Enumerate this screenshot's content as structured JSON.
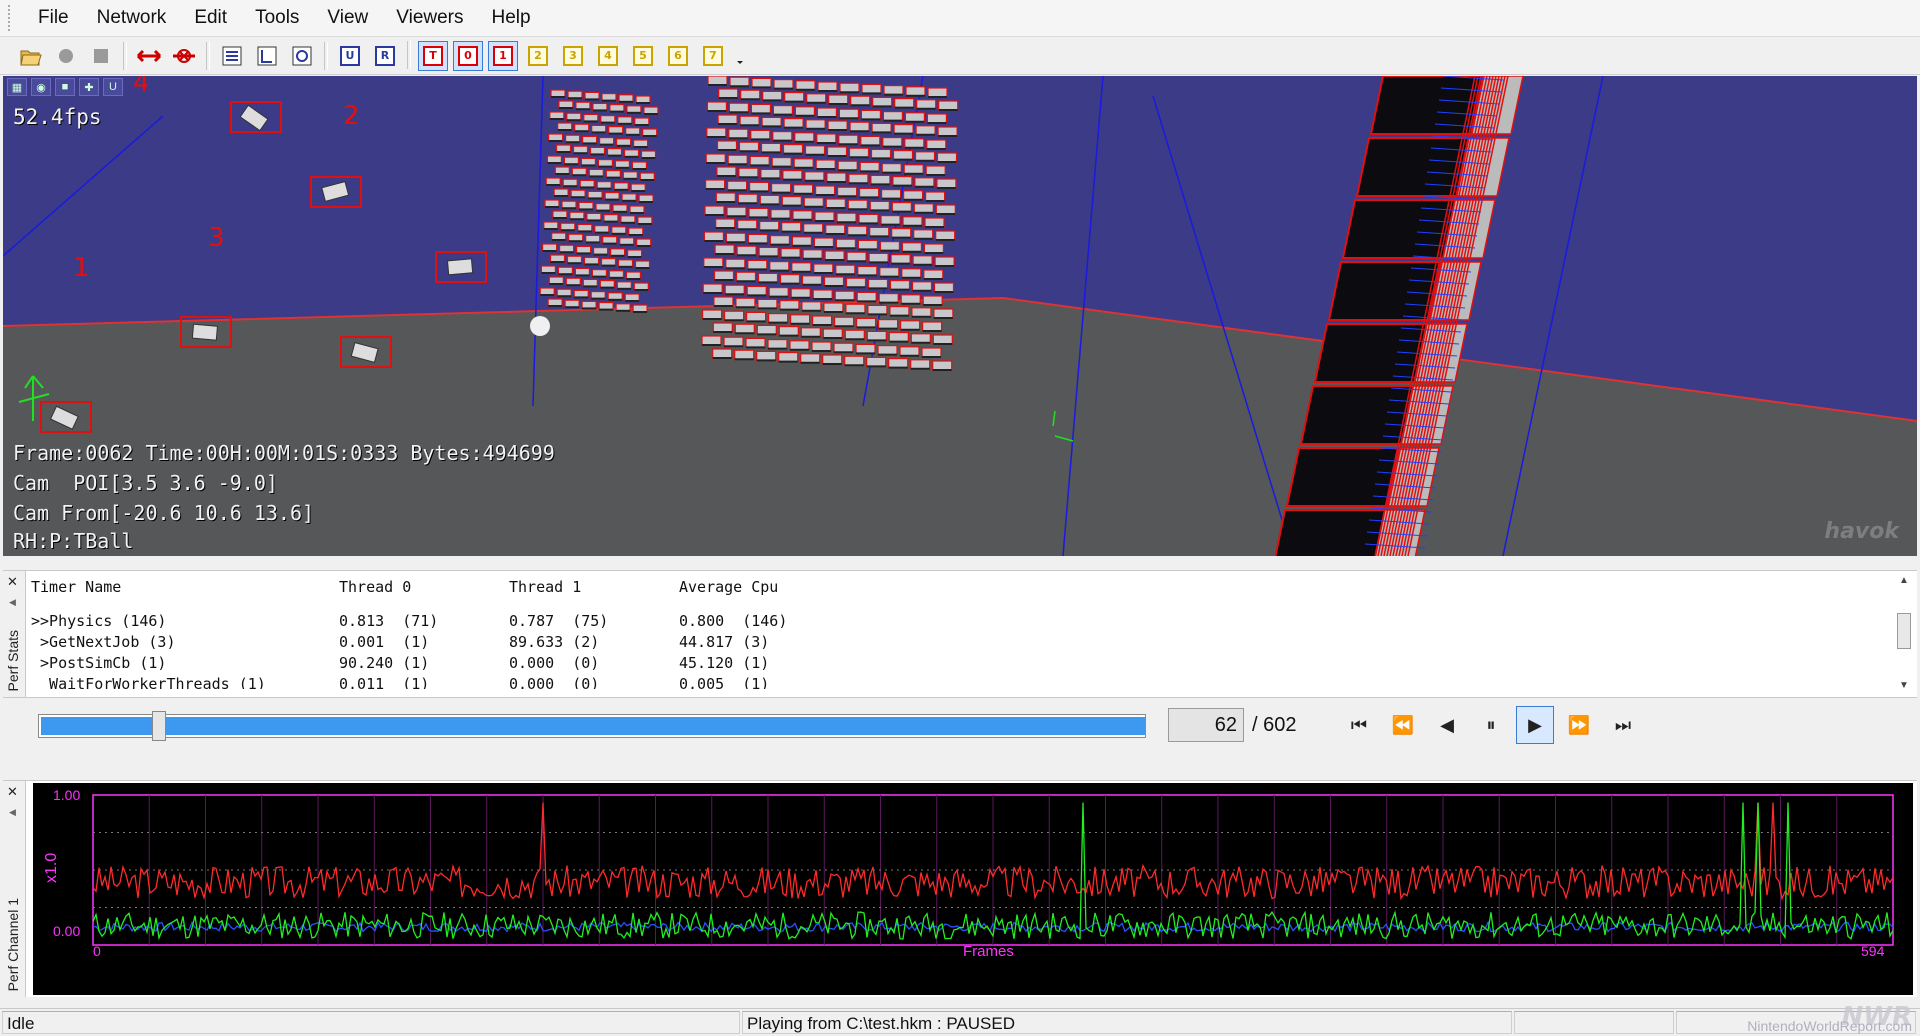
{
  "menu": [
    "File",
    "Network",
    "Edit",
    "Tools",
    "View",
    "Viewers",
    "Help"
  ],
  "toolbar": {
    "file_icons": [
      "open-folder-icon",
      "record-icon",
      "stop-icon",
      "connect-icon",
      "disconnect-icon"
    ],
    "view_icons": [
      "view-mode-1-icon",
      "view-mode-2-icon",
      "view-mode-3-icon"
    ],
    "layer_buttons": [
      {
        "label": "U",
        "on": false,
        "color": "blue"
      },
      {
        "label": "R",
        "on": false,
        "color": "blue"
      },
      {
        "label": "T",
        "on": true,
        "color": "red"
      },
      {
        "label": "0",
        "on": true,
        "color": "red"
      },
      {
        "label": "1",
        "on": true,
        "color": "red"
      },
      {
        "label": "2",
        "on": false,
        "color": "yellow"
      },
      {
        "label": "3",
        "on": false,
        "color": "yellow"
      },
      {
        "label": "4",
        "on": false,
        "color": "yellow"
      },
      {
        "label": "5",
        "on": false,
        "color": "yellow"
      },
      {
        "label": "6",
        "on": false,
        "color": "yellow"
      },
      {
        "label": "7",
        "on": false,
        "color": "yellow"
      }
    ]
  },
  "viewport": {
    "fps": "52.4fps",
    "frame_info": "Frame:0062 Time:00H:00M:01S:0333 Bytes:494699",
    "cam_poi": "Cam  POI[3.5 3.6 -9.0]",
    "cam_from": "Cam From[-20.6 10.6 13.6]",
    "rh": "RH:P:TBall",
    "logo": "havok",
    "scene_markers": [
      "1",
      "2",
      "3",
      "4"
    ],
    "overlay_icons": [
      "grid-icon",
      "camera-icon",
      "box-icon",
      "axes-icon",
      "u-icon"
    ]
  },
  "perf_stats": {
    "tab_label": "Perf Stats",
    "columns": [
      "Timer Name",
      "Thread 0",
      "Thread 1",
      "Average Cpu"
    ],
    "rows": [
      [
        ">>Physics (146)",
        "0.813  (71)",
        "0.787  (75)",
        "0.800  (146)"
      ],
      [
        " >GetNextJob (3)",
        "0.001  (1)",
        "89.633 (2)",
        "44.817 (3)"
      ],
      [
        " >PostSimCb (1)",
        "90.240 (1)",
        "0.000  (0)",
        "45.120 (1)"
      ],
      [
        "  WaitForWorkerThreads (1)",
        "0.011  (1)",
        "0.000  (0)",
        "0.005  (1)"
      ]
    ]
  },
  "timeline": {
    "current_frame": "62",
    "total_frames": "/ 602",
    "progress": 0.103,
    "transport": [
      {
        "name": "skip-to-start-icon",
        "glyph": "⏮",
        "on": false
      },
      {
        "name": "step-back-icon",
        "glyph": "⏪",
        "on": false
      },
      {
        "name": "reverse-play-icon",
        "glyph": "◀",
        "on": false
      },
      {
        "name": "pause-icon",
        "glyph": "⏸",
        "on": false
      },
      {
        "name": "play-icon",
        "glyph": "▶",
        "on": true
      },
      {
        "name": "step-forward-icon",
        "glyph": "⏩",
        "on": false
      },
      {
        "name": "skip-to-end-icon",
        "glyph": "⏭",
        "on": false
      }
    ]
  },
  "graph": {
    "tab_label": "Perf Channel 1",
    "y_axis_label": "x1.0",
    "y_max_label": "1.00",
    "y_min_label": "0.00",
    "x_min_label": "0",
    "x_max_label": "594",
    "x_axis_label": "Frames",
    "frame_range": [
      0,
      594
    ],
    "y_range": [
      0,
      1
    ],
    "colors": {
      "red": "#ff2a2a",
      "green": "#22ee22",
      "blue": "#2a52ff",
      "axis": "#ff33ff"
    }
  },
  "statusbar": {
    "state": "Idle",
    "playing": "Playing from C:\\test.hkm : PAUSED"
  },
  "watermark": {
    "big": "NWR",
    "small": "NintendoWorldReport.com"
  }
}
